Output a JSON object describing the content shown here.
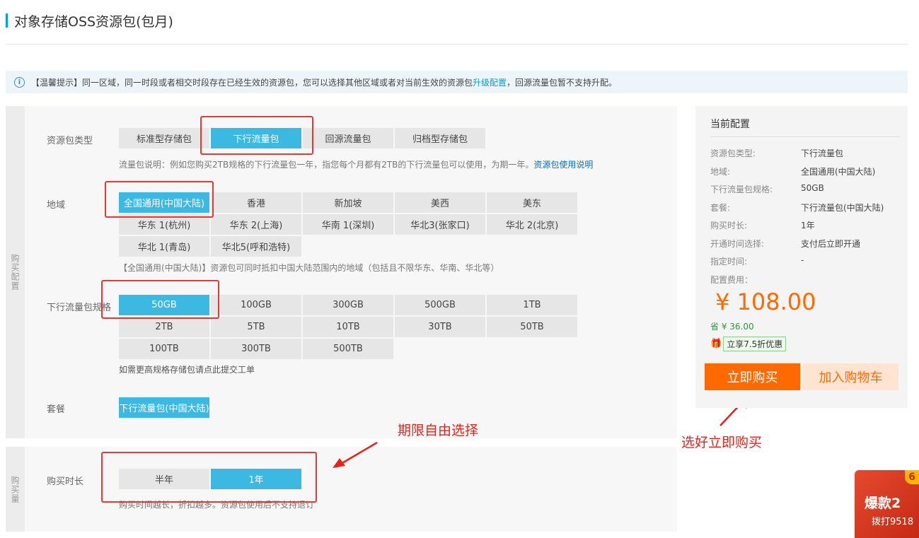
{
  "page": {
    "title": "对象存储OSS资源包(包月)"
  },
  "notice": {
    "icon": "info-icon",
    "text_before": "【温馨提示】同一区域，同一时段或者相交时段存在已经生效的资源包，您可以选择其他区域或者对当前生效的资源包",
    "link": "升级配置",
    "text_after": "，回源流量包暂不支持升配。"
  },
  "section1": {
    "side_label": "购买配置"
  },
  "section2": {
    "side_label": "购买量"
  },
  "package_type": {
    "label": "资源包类型",
    "options": [
      "标准型存储包",
      "下行流量包",
      "回源流量包",
      "归档型存储包"
    ],
    "selected": "下行流量包",
    "desc": "流量包说明：例如您购买2TB规格的下行流量包一年，指您每个月都有2TB的下行流量包可以使用，为期一年。",
    "desc_link": "资源包使用说明"
  },
  "region": {
    "label": "地域",
    "options": [
      "全国通用(中国大陆)",
      "香港",
      "新加坡",
      "美西",
      "美东",
      "华东 1(杭州)",
      "华东 2(上海)",
      "华南 1(深圳)",
      "华北3(张家口)",
      "华北 2(北京)",
      "华北 1(青岛)",
      "华北5(呼和浩特)"
    ],
    "selected": "全国通用(中国大陆)",
    "desc": "【全国通用(中国大陆)】资源包可同时抵扣中国大陆范围内的地域（包括且不限华东、华南、华北等）"
  },
  "spec": {
    "label": "下行流量包规格",
    "options": [
      "50GB",
      "100GB",
      "300GB",
      "500GB",
      "1TB",
      "2TB",
      "5TB",
      "10TB",
      "30TB",
      "50TB",
      "100TB",
      "300TB",
      "500TB"
    ],
    "selected": "50GB",
    "desc": "如需更高规格存储包请点此提交工单"
  },
  "plan": {
    "label": "套餐",
    "options": [
      "下行流量包(中国大陆)"
    ],
    "selected": "下行流量包(中国大陆)"
  },
  "duration": {
    "label": "购买时长",
    "options": [
      "半年",
      "1年"
    ],
    "selected": "1年",
    "desc": "购买时间越长，折扣越多。资源包使用后不支持退订"
  },
  "annotations": {
    "period": "期限自由选择",
    "buy": "选好立即购买"
  },
  "config": {
    "title": "当前配置",
    "rows": [
      {
        "k": "资源包类型:",
        "v": "下行流量包"
      },
      {
        "k": "地域:",
        "v": "全国通用(中国大陆)"
      },
      {
        "k": "下行流量包规格:",
        "v": "50GB"
      },
      {
        "k": "套餐:",
        "v": "下行流量包(中国大陆)"
      },
      {
        "k": "购买时长:",
        "v": "1年"
      },
      {
        "k": "开通时间选择:",
        "v": "支付后立即开通"
      },
      {
        "k": "指定时间:",
        "v": "-"
      }
    ],
    "fee_label": "配置费用：",
    "price": "¥ 108.00",
    "save": "省 ¥ 36.00",
    "promo": "立享7.5折优惠",
    "buy_label": "立即购买",
    "cart_label": "加入购物车"
  },
  "ad": {
    "line1": "爆款2",
    "line2": "拨打9518",
    "corner": "6"
  },
  "colors": {
    "accent": "#3cb9e2",
    "orange": "#ff6a00",
    "annotation": "#e8221a"
  }
}
